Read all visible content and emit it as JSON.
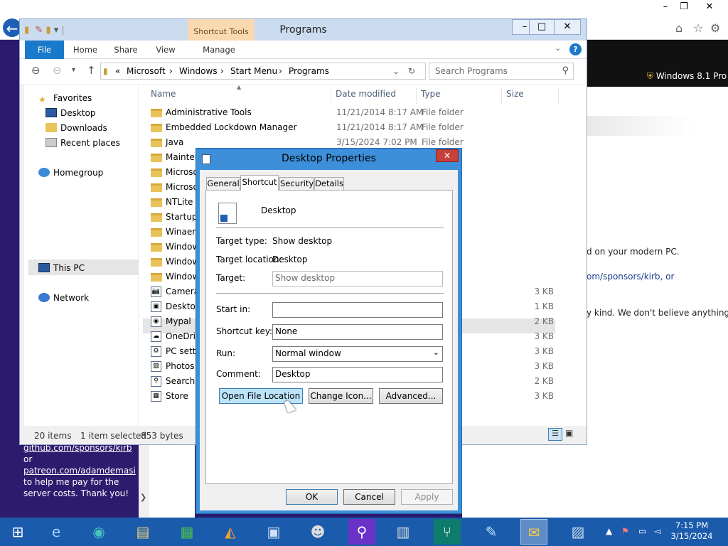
{
  "background": {
    "window_controls": [
      "–",
      "❐",
      "✕"
    ],
    "windows_label": "Windows 8.1 Pro",
    "text_lines": [
      "d on your modern PC.",
      "om/sponsors/kirb, or",
      "y kind. We don't believe anything"
    ],
    "purple_lines": [
      "github.com/sponsors/kirb",
      "or",
      "patreon.com/adamdemasi",
      "to help me pay for the",
      "server costs. Thank you!"
    ]
  },
  "explorer": {
    "title": "Programs",
    "contextual_tab": "Shortcut Tools",
    "ribbon_tabs": [
      "File",
      "Home",
      "Share",
      "View",
      "Manage"
    ],
    "address": [
      "«",
      "Microsoft",
      "›",
      "Windows",
      "›",
      "Start Menu",
      "›",
      "Programs"
    ],
    "search_placeholder": "Search Programs",
    "nav": {
      "favorites": "Favorites",
      "desktop": "Desktop",
      "downloads": "Downloads",
      "recent": "Recent places",
      "homegroup": "Homegroup",
      "thispc": "This PC",
      "network": "Network"
    },
    "columns": [
      "Name",
      "Date modified",
      "Type",
      "Size"
    ],
    "rows": [
      {
        "name": "Administrative Tools",
        "date": "11/21/2014 8:17 AM",
        "type": "File folder",
        "size": ""
      },
      {
        "name": "Embedded Lockdown Manager",
        "date": "11/21/2014 8:17 AM",
        "type": "File folder",
        "size": ""
      },
      {
        "name": "Java",
        "date": "3/15/2024 7:02 PM",
        "type": "File folder",
        "size": ""
      },
      {
        "name": "Mainter",
        "date": "",
        "type": "",
        "size": ""
      },
      {
        "name": "Microso",
        "date": "",
        "type": "",
        "size": ""
      },
      {
        "name": "Microso",
        "date": "",
        "type": "",
        "size": ""
      },
      {
        "name": "NTLite",
        "date": "",
        "type": "",
        "size": ""
      },
      {
        "name": "Startup",
        "date": "",
        "type": "",
        "size": ""
      },
      {
        "name": "Winaero",
        "date": "",
        "type": "",
        "size": ""
      },
      {
        "name": "Window",
        "date": "",
        "type": "",
        "size": ""
      },
      {
        "name": "Window",
        "date": "",
        "type": "",
        "size": ""
      },
      {
        "name": "Window",
        "date": "",
        "type": "",
        "size": ""
      },
      {
        "name": "Camera",
        "date": "",
        "type": "",
        "size": "3 KB"
      },
      {
        "name": "Desktop",
        "date": "",
        "type": "",
        "size": "1 KB"
      },
      {
        "name": "Mypal",
        "date": "",
        "type": "",
        "size": "2 KB"
      },
      {
        "name": "OneDriv",
        "date": "",
        "type": "",
        "size": "3 KB"
      },
      {
        "name": "PC setti",
        "date": "",
        "type": "",
        "size": "3 KB"
      },
      {
        "name": "Photos",
        "date": "",
        "type": "",
        "size": "3 KB"
      },
      {
        "name": "Search",
        "date": "",
        "type": "",
        "size": "2 KB"
      },
      {
        "name": "Store",
        "date": "",
        "type": "",
        "size": "3 KB"
      }
    ],
    "status": {
      "count": "20 items",
      "selected": "1 item selected",
      "bytes": "853 bytes"
    }
  },
  "dialog": {
    "title": "Desktop Properties",
    "close": "✕",
    "tabs": [
      "General",
      "Shortcut",
      "Security",
      "Details"
    ],
    "name": "Desktop",
    "target_type_label": "Target type:",
    "target_type_value": "Show desktop",
    "target_location_label": "Target location:",
    "target_location_value": "Desktop",
    "target_label": "Target:",
    "target_value": "Show desktop",
    "start_in_label": "Start in:",
    "start_in_value": "",
    "shortcut_key_label": "Shortcut key:",
    "shortcut_key_value": "None",
    "run_label": "Run:",
    "run_value": "Normal window",
    "comment_label": "Comment:",
    "comment_value": "Desktop",
    "buttons": {
      "open_location": "Open File Location",
      "change_icon": "Change Icon...",
      "advanced": "Advanced...",
      "ok": "OK",
      "cancel": "Cancel",
      "apply": "Apply"
    }
  },
  "taskbar": {
    "clock_time": "7:15 PM",
    "clock_date": "3/15/2024"
  }
}
